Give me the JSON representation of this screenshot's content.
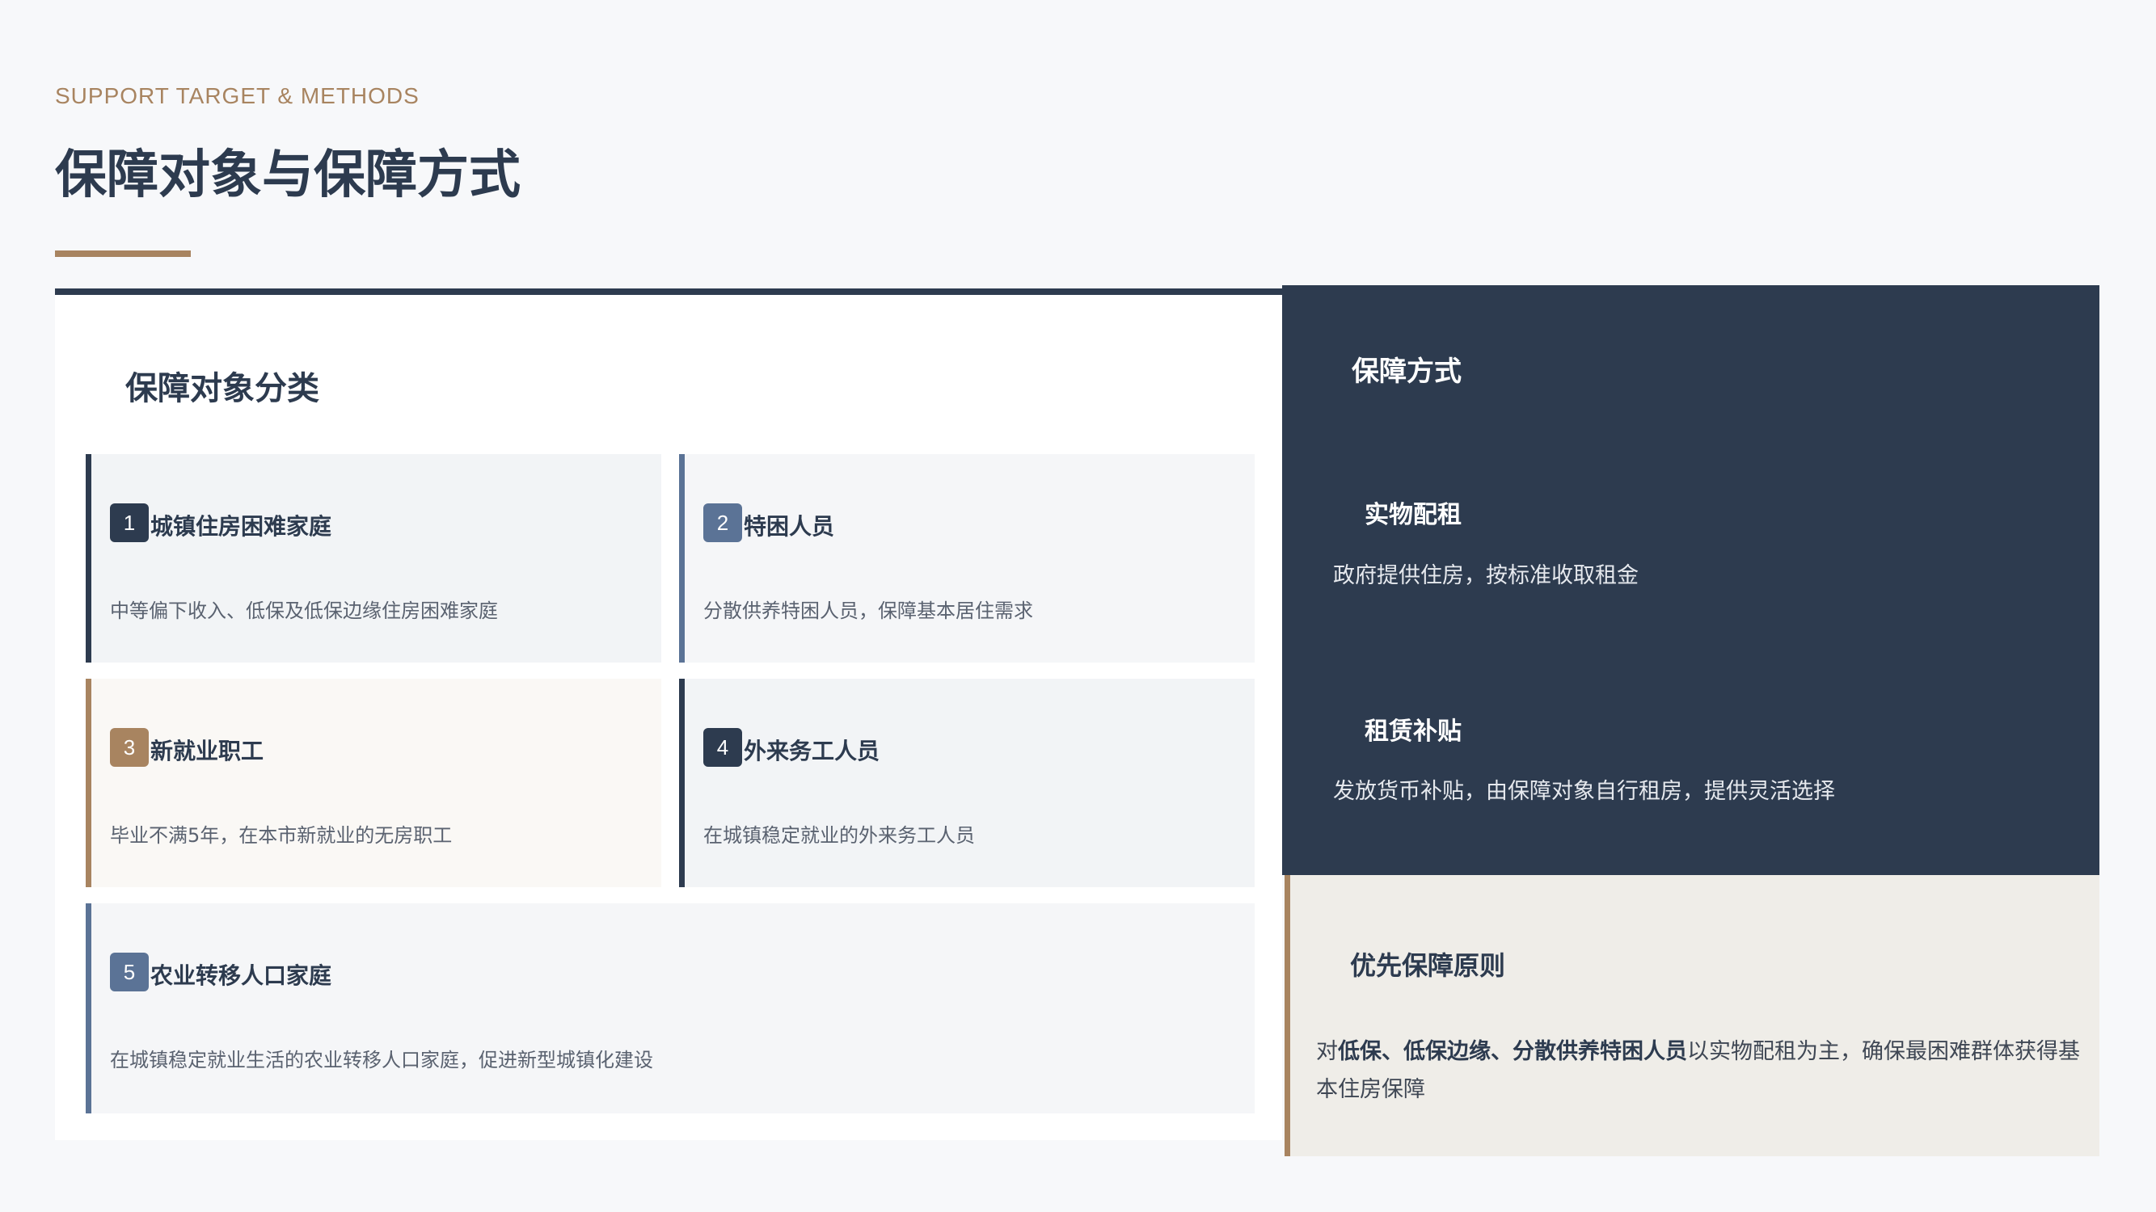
{
  "header": {
    "subtitle": "SUPPORT TARGET & METHODS",
    "title": "保障对象与保障方式"
  },
  "targets": {
    "heading": "保障对象分类",
    "cards": [
      {
        "num": "1",
        "title": "城镇住房困难家庭",
        "desc": "中等偏下收入、低保及低保边缘住房困难家庭"
      },
      {
        "num": "2",
        "title": "特困人员",
        "desc": "分散供养特困人员，保障基本居住需求"
      },
      {
        "num": "3",
        "title": "新就业职工",
        "desc": "毕业不满5年，在本市新就业的无房职工"
      },
      {
        "num": "4",
        "title": "外来务工人员",
        "desc": "在城镇稳定就业的外来务工人员"
      },
      {
        "num": "5",
        "title": "农业转移人口家庭",
        "desc": "在城镇稳定就业生活的农业转移人口家庭，促进新型城镇化建设"
      }
    ]
  },
  "methods": {
    "heading": "保障方式",
    "items": [
      {
        "title": "实物配租",
        "desc": "政府提供住房，按标准收取租金"
      },
      {
        "title": "租赁补贴",
        "desc": "发放货币补贴，由保障对象自行租房，提供灵活选择"
      }
    ]
  },
  "priority": {
    "heading": "优先保障原则",
    "prefix": "对",
    "emphasis": "低保、低保边缘、分散供养特困人员",
    "suffix": "以实物配租为主，确保最困难群体获得基本住房保障"
  },
  "colors": {
    "navy": "#2d3b4f",
    "slate_blue": "#5b7396",
    "gold": "#a88460",
    "card_gray": "#f2f4f6",
    "card_cream": "#faf8f5",
    "priority_bg": "#efede8"
  }
}
